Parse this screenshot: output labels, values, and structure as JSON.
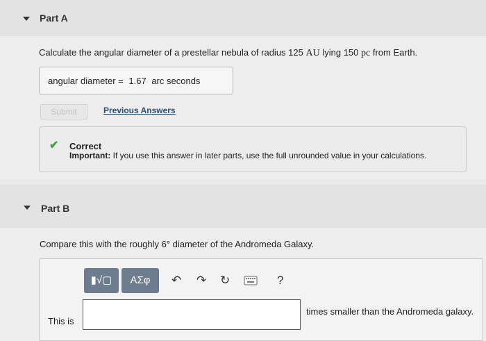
{
  "part_a": {
    "title": "Part A",
    "question_pre": "Calculate the angular diameter of a prestellar nebula of radius 125",
    "question_unit1": "AU",
    "question_mid": "lying 150",
    "question_unit2": "pc",
    "question_post": "from Earth.",
    "answer_label": "angular diameter =",
    "answer_value": "1.67",
    "answer_unit": "arc seconds",
    "submit_label": "Submit",
    "previous_answers_label": "Previous Answers",
    "feedback": {
      "title": "Correct",
      "important_label": "Important:",
      "message": "If you use this answer in later parts, use the full unrounded value in your calculations."
    }
  },
  "part_b": {
    "title": "Part B",
    "question": "Compare this with the roughly 6° diameter of the Andromeda Galaxy.",
    "toolbar": {
      "template_label": "▮√▢",
      "greek_label": "ΑΣφ",
      "undo_icon": "undo-icon",
      "redo_icon": "redo-icon",
      "reset_icon": "reset-icon",
      "keyboard_icon": "keyboard-icon",
      "help_label": "?"
    },
    "prefix": "This is",
    "input_value": "",
    "suffix": "times smaller than the Andromeda galaxy."
  },
  "colors": {
    "accent": "#2a4f7c",
    "success": "#3f9e3a",
    "toolbar_button": "#6d7d8e"
  }
}
